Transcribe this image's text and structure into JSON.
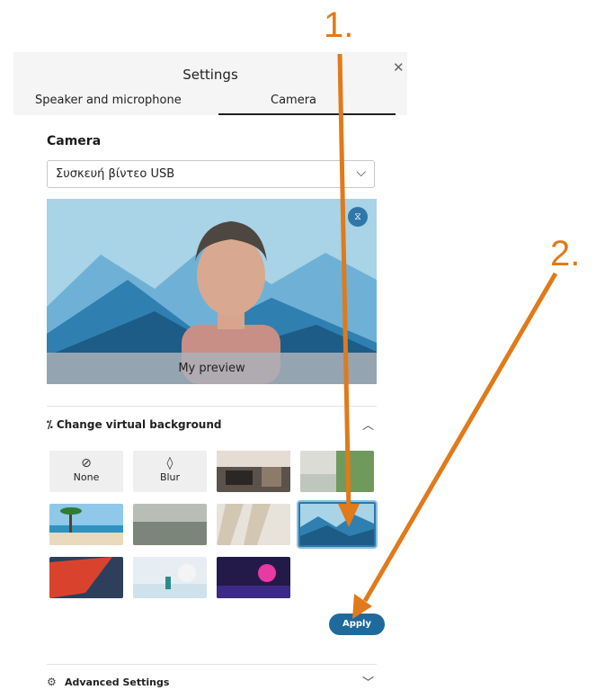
{
  "settings": {
    "title": "Settings",
    "close_icon": "close-icon",
    "tabs": [
      {
        "label": "Speaker and microphone"
      },
      {
        "label": "Camera"
      }
    ],
    "active_tab": "Camera"
  },
  "camera": {
    "section_label": "Camera",
    "device_value": "Συσκευή βίντεο USB",
    "preview_label": "My preview",
    "mirror_icon": "mirror-icon"
  },
  "virtual_background": {
    "header": "Change virtual background",
    "header_icon": "magic-wand-icon",
    "options": [
      {
        "label": "None",
        "icon": "none-circle-icon"
      },
      {
        "label": "Blur",
        "icon": "blur-drop-icon"
      }
    ],
    "selected_index": 7,
    "apply_label": "Apply"
  },
  "advanced": {
    "label": "Advanced Settings",
    "icon": "gear-icon"
  },
  "annotations": {
    "step1": "1.",
    "step2": "2."
  },
  "colors": {
    "accent": "#1e6a9c",
    "annotation": "#e07a1a"
  }
}
